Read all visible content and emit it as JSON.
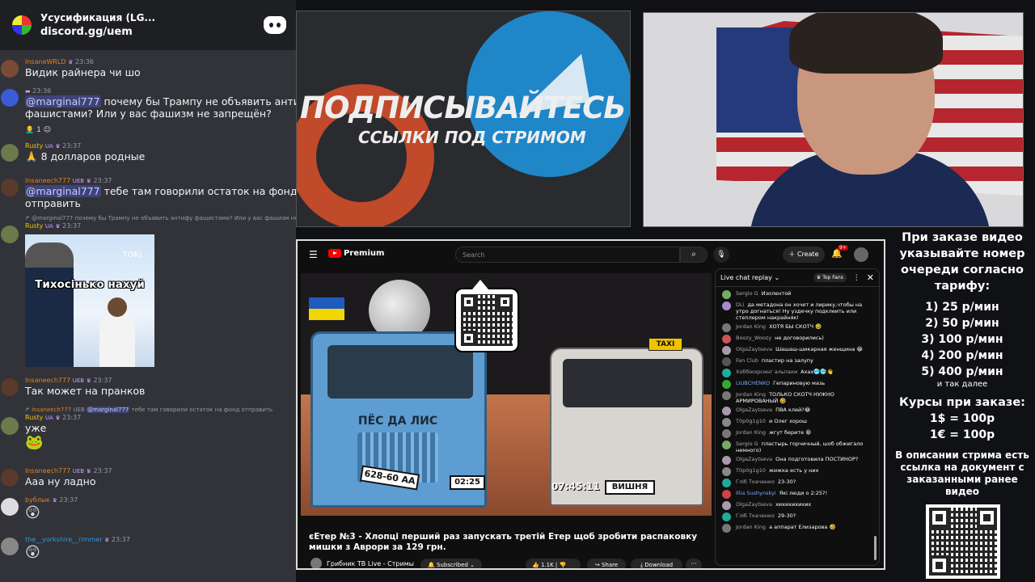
{
  "discord": {
    "server_name": "Усусификация (LG...",
    "invite": "discord.gg/uem",
    "messages": [
      {
        "name": "InsaneWRLD",
        "time": "23:36",
        "text": "Видик райнера чи шо"
      },
      {
        "name": "",
        "time": "23:36",
        "mention": "@marginal777",
        "text": " почему бы Трампу не объявить антифу",
        "text2": "фашистами? Или у вас фашизм не запрещён?",
        "reactions": "1"
      },
      {
        "name": "Rusty",
        "tag": "UA",
        "time": "23:37",
        "emoji": "🙏",
        "text": "8 долларов родные"
      },
      {
        "name": "Insaneech777",
        "tag": "UEB",
        "time": "23:37",
        "mention": "@marginal777",
        "text": " тебе там говорили остаток на фонд",
        "text2": "отправить"
      },
      {
        "reply": "@marginal777 почему бы Трампу не объявить антифу фашистами? Или у вас фашизм не зап",
        "name": "Rusty",
        "tag": "UA",
        "time": "23:37",
        "gif_caption": "Тихосінько нахуй",
        "gif_tok": "TOKi"
      },
      {
        "name": "Insaneech777",
        "tag": "UEB",
        "time": "23:37",
        "text": "Так может на пранков"
      },
      {
        "reply_name": "Insaneech777",
        "reply_tag": "UEB",
        "reply_mention": "@marginal777",
        "reply": " тебе там говорили остаток на фонд отправить",
        "name": "Rusty",
        "tag": "UA",
        "time": "23:37",
        "text": "уже"
      },
      {
        "name": "Insaneech777",
        "tag": "UEB",
        "time": "23:37",
        "text": "Ааа ну ладно"
      },
      {
        "name": "bублык",
        "time": "23:37"
      },
      {
        "name": "the__yorkshire__rimmer",
        "time": "23:37"
      }
    ]
  },
  "banner": {
    "main": "ПОДПИСЫВАЙТЕСЬ",
    "sub": "ССЫЛКИ ПОД СТРИМОМ"
  },
  "youtube": {
    "logo_text": "Premium",
    "search_placeholder": "Search",
    "create_label": "Create",
    "notif_count": "9+",
    "video_title": "єЕтер №3 - Хлопці перший раз запускать третій Етер щоб зробити распаковку мишки з Аврори за 129 грн.",
    "channel": "Грибник ТВ Live - Стримы",
    "subscribed": "Subscribed",
    "likes": "1.1K",
    "share": "Share",
    "download": "Download",
    "video": {
      "truck_label": "ПЁС ДА ЛИС",
      "plate1": "628-60 АА",
      "time1": "02:25",
      "time2": "07:45:11",
      "plate2": "ВИШНЯ",
      "taxi": "TAXI"
    },
    "chat": {
      "title": "Live chat replay",
      "top_fans": "Top Fans",
      "messages": [
        {
          "name": "Sergio G",
          "text": "Изолентой",
          "color": "#7a6"
        },
        {
          "name": "DLi",
          "text": "да метадона он хочет и лирику,чтобы на утро догнаться! Ну уздечку подклеить или степлером накрайняк!",
          "color": "#a8c"
        },
        {
          "name": "Jordan King",
          "text": "ХОТЯ БЫ СКОТЧ 🤣",
          "color": "#777"
        },
        {
          "name": "Boozy_Woozy",
          "text": "не договорились)",
          "color": "#c55"
        },
        {
          "name": "OlgaZaytseva",
          "text": "Шашаш-шикарная женщина 😂",
          "color": "#a9a"
        },
        {
          "name": "Fan Club",
          "text": "пластир на залупу",
          "color": "#555"
        },
        {
          "name": "Хоббікорсинг альпаки",
          "text": "Ахах🥶🥶👋",
          "color": "#2a9"
        },
        {
          "name": "LIUBCHENKO",
          "text": "Гепариновую мазь",
          "color": "#3a3",
          "verified": true
        },
        {
          "name": "Jordan King",
          "text": "ТОЛЬКО СКОТЧ НУЖНО АРМИРОВАНЫЙ 🤣",
          "color": "#777"
        },
        {
          "name": "OlgaZaytseva",
          "text": "ПВА клей?😂",
          "color": "#a9a"
        },
        {
          "name": "T0p0g1g10",
          "text": "и Олег хорош",
          "color": "#888"
        },
        {
          "name": "Jordan King",
          "text": "жгут берите 😁",
          "color": "#777"
        },
        {
          "name": "Sergio G",
          "text": "пластырь горчичный, шоб обжигало немного)",
          "color": "#7a6"
        },
        {
          "name": "OlgaZaytseva",
          "text": "Она подготовила ПОСТИНОР?",
          "color": "#a9a"
        },
        {
          "name": "T0p0g1g10",
          "text": "жижка есть у них",
          "color": "#888"
        },
        {
          "name": "Гліб Ткаченко",
          "text": "23-30?",
          "color": "#2a9"
        },
        {
          "name": "Illia Sushynskyi",
          "text": "Які люди о 2:25?!",
          "color": "#c44",
          "verified": true
        },
        {
          "name": "OlgaZaytseva",
          "text": "хихихихихих",
          "color": "#a9a"
        },
        {
          "name": "Гліб Ткаченко",
          "text": "29-30?",
          "color": "#2a9"
        },
        {
          "name": "Jordan King",
          "text": "а аппарат Елизарова 🤣",
          "color": "#777"
        }
      ]
    }
  },
  "info": {
    "header": "При заказе видео указывайте номер очереди согласно тарифу:",
    "prices": [
      "1) 25 р/мин",
      "2) 50 р/мин",
      "3) 100 р/мин",
      "4) 200 р/мин",
      "5) 400 р/мин"
    ],
    "and_so_on": "и так далее",
    "courses_header": "Курсы при заказе:",
    "courses": [
      "1$ = 100р",
      "1€ = 100р"
    ],
    "footer": "В описании стрима есть ссылка на документ с заказанными ранее видео"
  }
}
